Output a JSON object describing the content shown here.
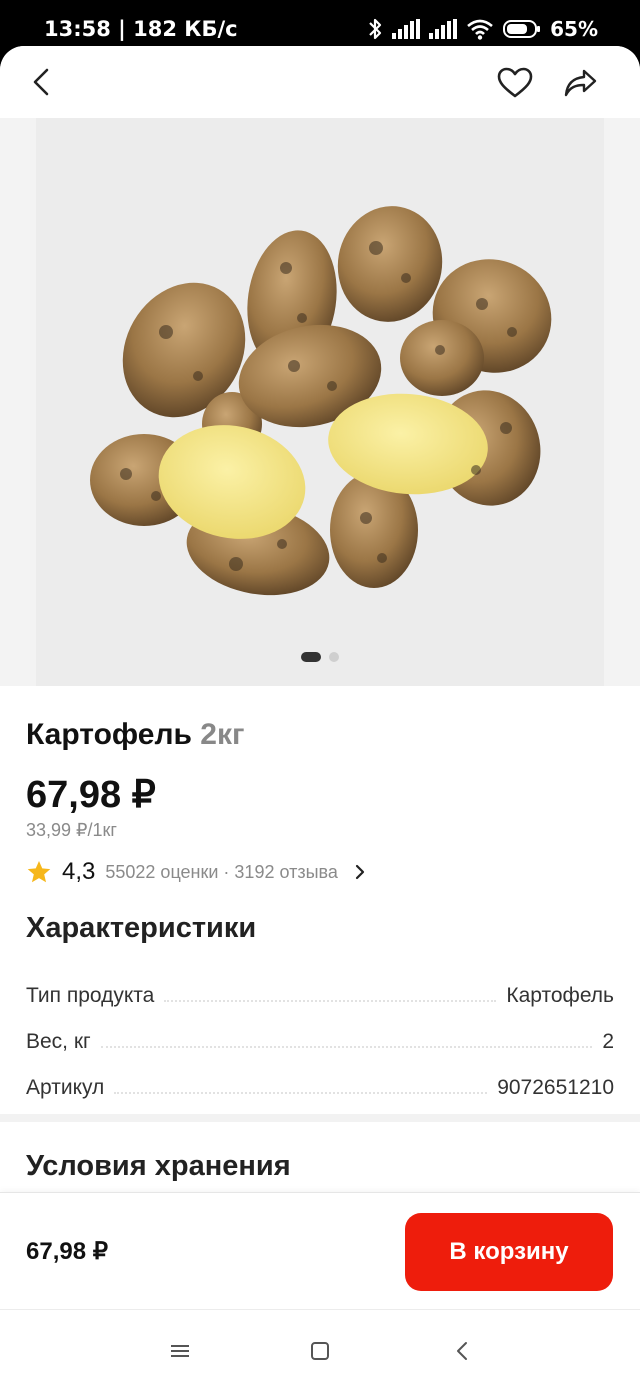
{
  "status_bar": {
    "time_speed": "13:58 | 182 КБ/с",
    "battery": "65%",
    "icons": [
      "bluetooth-icon",
      "signal-icon",
      "signal-icon",
      "wifi-icon",
      "battery-icon"
    ]
  },
  "topbar": {
    "icons": [
      "back-arrow-icon",
      "heart-icon",
      "share-icon"
    ]
  },
  "gallery": {
    "image": "potatoes-product-photo",
    "pages": 2,
    "active_page": 1
  },
  "product": {
    "name": "Картофель",
    "weight": "2кг",
    "price": "67,98 ₽",
    "unit_price": "33,99 ₽/1кг",
    "rating": "4,3",
    "rating_meta": "55022 оценки · 3192 отзыва"
  },
  "specs": {
    "title": "Характеристики",
    "rows": [
      {
        "label": "Тип продукта",
        "value": "Картофель"
      },
      {
        "label": "Вес, кг",
        "value": "2"
      },
      {
        "label": "Артикул",
        "value": "9072651210"
      }
    ]
  },
  "storage": {
    "title": "Условия хранения"
  },
  "bottom_bar": {
    "price": "67,98 ₽",
    "button": "В корзину",
    "accent": "#ee1d0c"
  },
  "nav_bar": {
    "icons": [
      "menu-icon",
      "home-icon",
      "back-icon"
    ]
  }
}
